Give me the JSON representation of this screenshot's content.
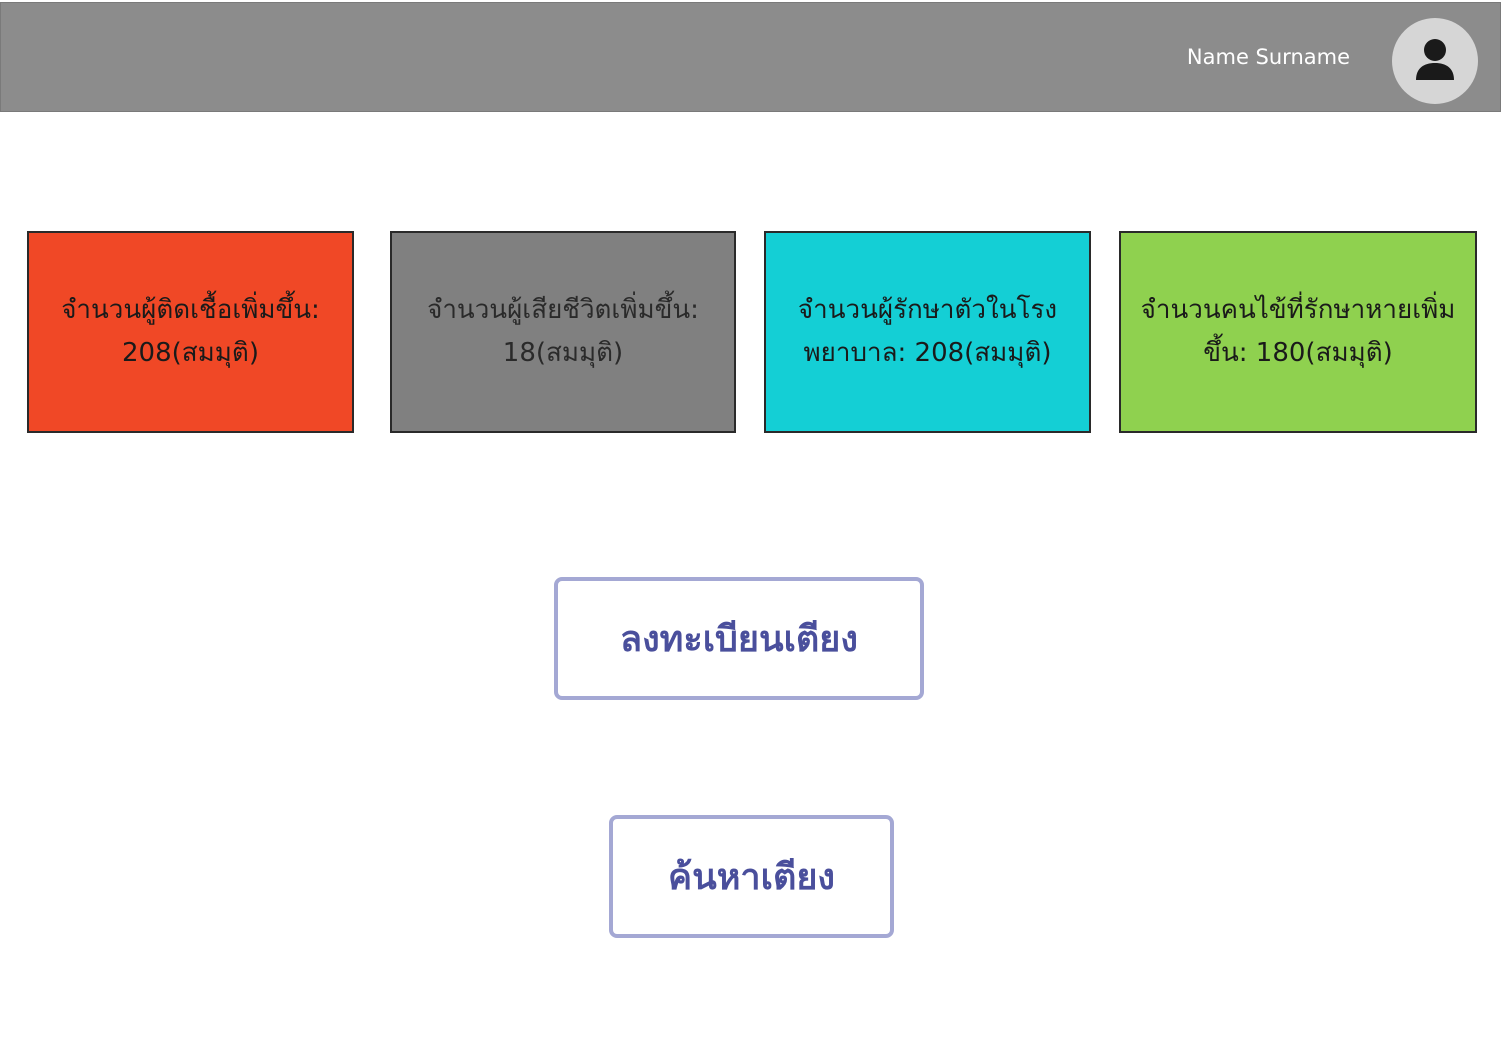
{
  "header": {
    "user_name": "Name Surname",
    "avatar_icon": "user-icon"
  },
  "stats": {
    "infected": "จำนวนผู้ติดเชื้อเพิ่มขึ้น: 208(สมมุติ)",
    "deaths": "จำนวนผู้เสียชีวิตเพิ่มขึ้น: 18(สมมุติ)",
    "hospitalized": "จำนวนผู้รักษาตัวในโรงพยาบาล: 208(สมมุติ)",
    "recovered": "จำนวนคนไข้ที่รักษาหายเพิ่มขึ้น: 180(สมมุติ)"
  },
  "actions": {
    "register_bed": "ลงทะเบียนเตียง",
    "search_bed": "ค้นหาเตียง"
  },
  "colors": {
    "header": "#8c8c8c",
    "infected": "#f04826",
    "deaths": "#808080",
    "hospitalized": "#14cfd5",
    "recovered": "#8fd14f",
    "button_border": "#a4a8d4",
    "button_text": "#4a4f9c"
  }
}
